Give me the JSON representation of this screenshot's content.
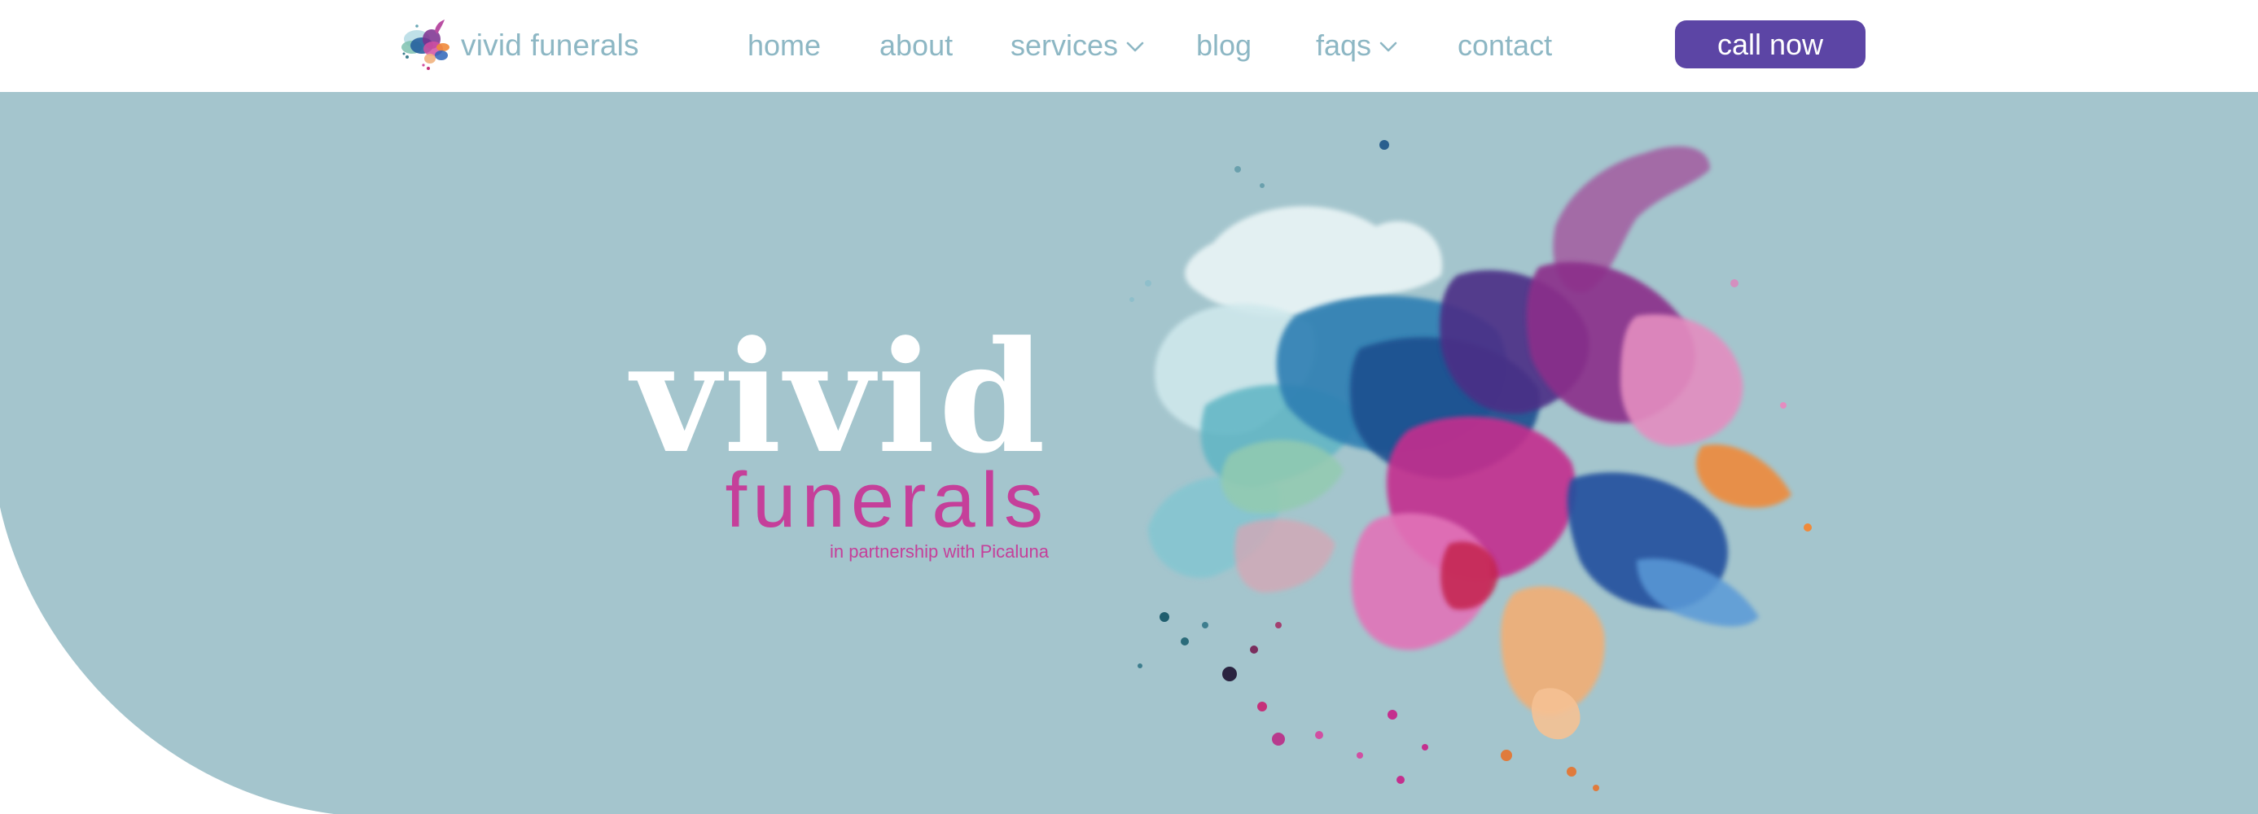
{
  "brand": {
    "name": "vivid funerals",
    "text_color": "#8db7c4",
    "logo_icon": "paint-splash-logo-icon"
  },
  "nav": {
    "items": [
      {
        "label": "home"
      },
      {
        "label": "about"
      },
      {
        "label": "services",
        "icon": "chevron-down-icon"
      },
      {
        "label": "blog"
      },
      {
        "label": "faqs",
        "icon": "chevron-down-icon"
      },
      {
        "label": "contact"
      }
    ],
    "color": "#8db7c4"
  },
  "cta": {
    "label": "call now",
    "background": "#5c45a5",
    "text_color": "#ffffff"
  },
  "hero": {
    "background": "#a4c5cd",
    "title_main": "vivid",
    "title_sub": "funerals",
    "partnership": "in partnership with Picaluna",
    "title_main_color": "#ffffff",
    "title_sub_color": "#c53f9a",
    "image": "watercolor-paint-splash-illustration"
  }
}
